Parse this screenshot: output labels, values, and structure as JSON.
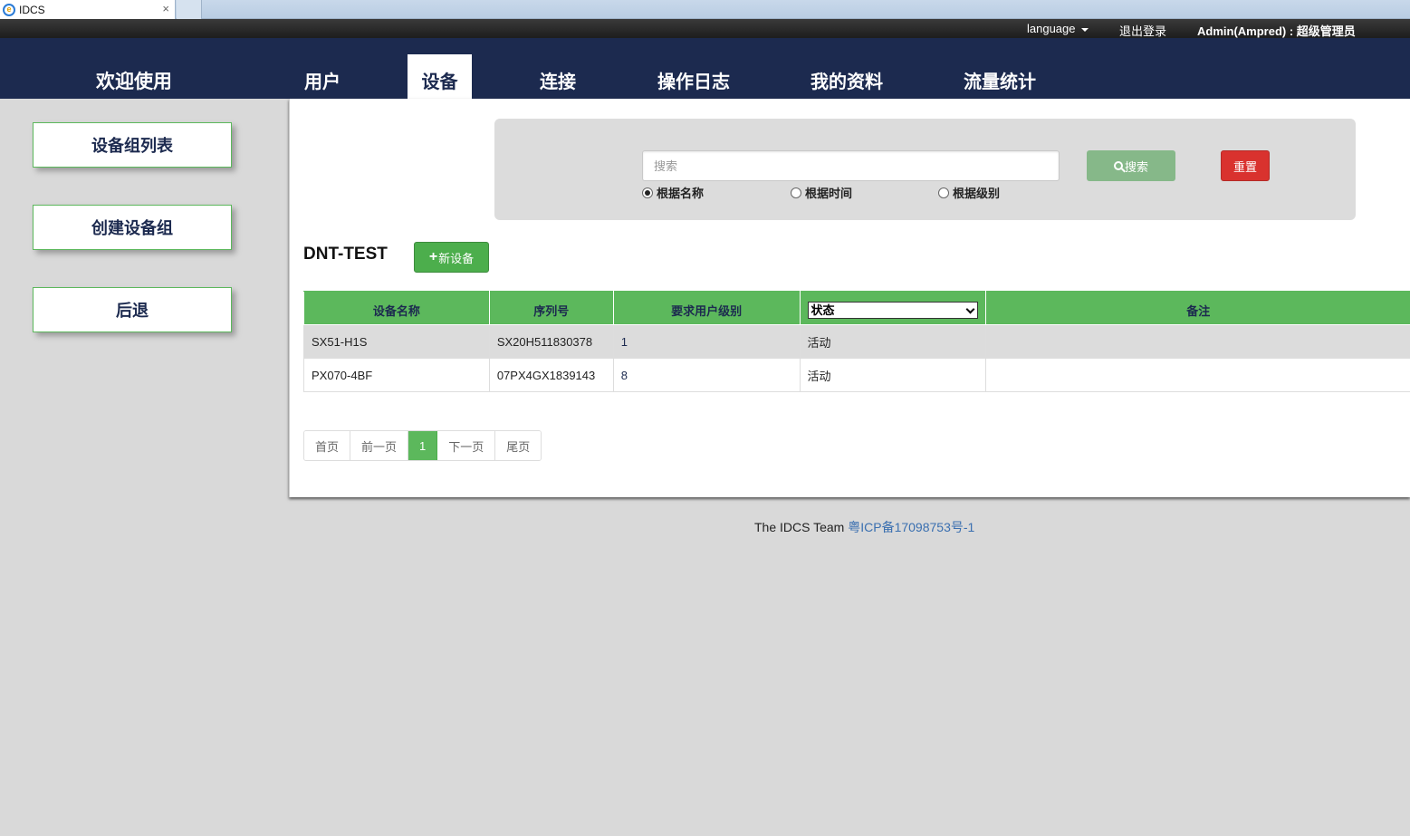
{
  "browser": {
    "tab_title": "IDCS",
    "close_glyph": "×",
    "ie_glyph": "e"
  },
  "topbar": {
    "language": "language",
    "logout": "退出登录",
    "user": "Admin(Ampred) : 超级管理员"
  },
  "nav": {
    "brand": "欢迎使用",
    "items": [
      {
        "label": "用户"
      },
      {
        "label": "设备",
        "active": true
      },
      {
        "label": "连接"
      },
      {
        "label": "操作日志"
      },
      {
        "label": "我的资料"
      },
      {
        "label": "流量统计"
      }
    ]
  },
  "sidebar": {
    "items": [
      {
        "label": "设备组列表"
      },
      {
        "label": "创建设备组"
      },
      {
        "label": "后退"
      }
    ]
  },
  "search": {
    "placeholder": "搜索",
    "search_label": "搜索",
    "reset_label": "重置",
    "options": [
      {
        "label": "根据名称",
        "checked": true
      },
      {
        "label": "根据时间",
        "checked": false
      },
      {
        "label": "根据级别",
        "checked": false
      }
    ]
  },
  "group": {
    "title": "DNT-TEST",
    "new_device_label": "新设备",
    "plus_glyph": "+"
  },
  "table": {
    "headers": {
      "name": "设备名称",
      "serial": "序列号",
      "level": "要求用户级别",
      "status": "状态",
      "note": "备注"
    },
    "rows": [
      {
        "name": "SX51-H1S",
        "serial": "SX20H511830378",
        "level": "1",
        "status": "活动",
        "note": ""
      },
      {
        "name": "PX070-4BF",
        "serial": "07PX4GX1839143",
        "level": "8",
        "status": "活动",
        "note": ""
      }
    ]
  },
  "pagination": {
    "first": "首页",
    "prev": "前一页",
    "current": "1",
    "next": "下一页",
    "last": "尾页"
  },
  "footer": {
    "team": "The IDCS Team",
    "icp": "粤ICP备17098753号-1"
  },
  "colors": {
    "nav_bg": "#1c2a4f",
    "accent_green": "#5cb85c",
    "reset_red": "#d9322e"
  }
}
